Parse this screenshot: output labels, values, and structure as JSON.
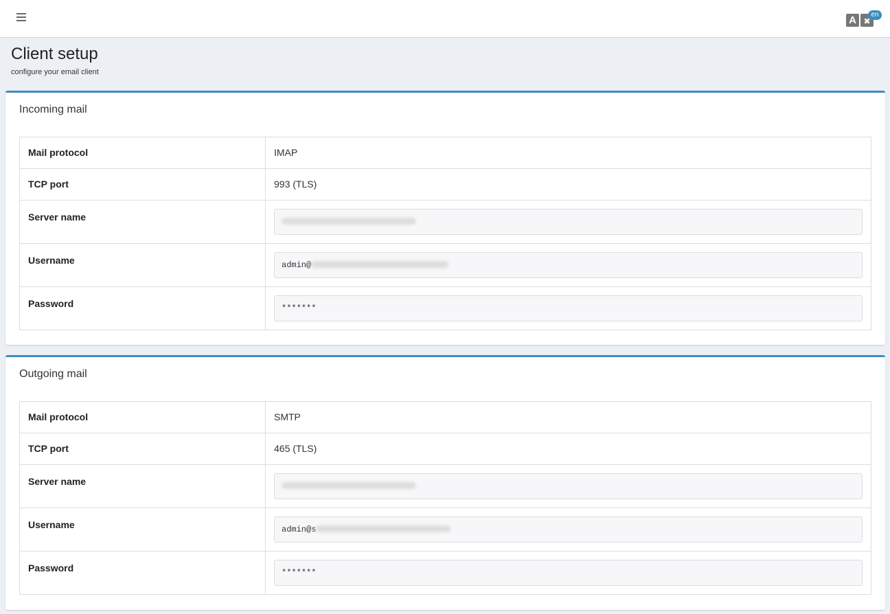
{
  "header": {
    "menu_icon": "hamburger-icon",
    "language": {
      "letter": "A",
      "glyph": "✖",
      "code": "en"
    }
  },
  "page": {
    "title": "Client setup",
    "subtitle": "configure your email client"
  },
  "incoming": {
    "title": "Incoming mail",
    "rows": {
      "protocol": {
        "label": "Mail protocol",
        "value": "IMAP"
      },
      "port": {
        "label": "TCP port",
        "value": "993 (TLS)"
      },
      "server": {
        "label": "Server name",
        "value": ""
      },
      "username": {
        "label": "Username",
        "value": "admin@"
      },
      "password": {
        "label": "Password",
        "value": "*******"
      }
    }
  },
  "outgoing": {
    "title": "Outgoing mail",
    "rows": {
      "protocol": {
        "label": "Mail protocol",
        "value": "SMTP"
      },
      "port": {
        "label": "TCP port",
        "value": "465 (TLS)"
      },
      "server": {
        "label": "Server name",
        "value": ""
      },
      "username": {
        "label": "Username",
        "value": "admin@s"
      },
      "password": {
        "label": "Password",
        "value": "*******"
      }
    }
  },
  "colors": {
    "accent": "#3c8dbc",
    "background": "#ecf0f5",
    "field_background": "#f7f7f9"
  }
}
